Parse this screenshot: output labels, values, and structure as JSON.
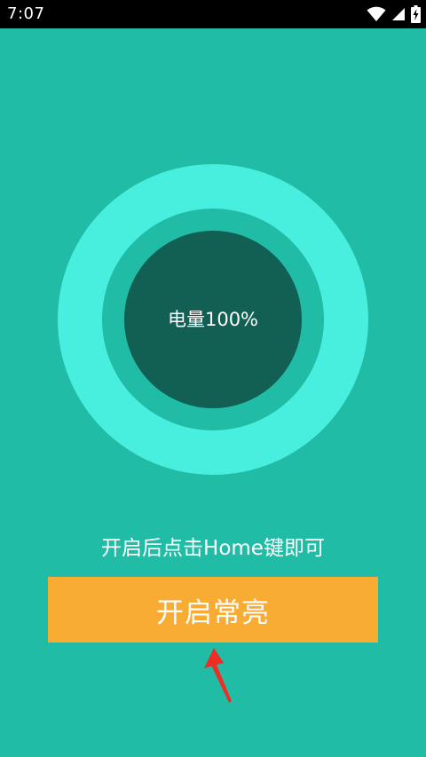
{
  "status_bar": {
    "time": "7:07",
    "icons": [
      "wifi-icon",
      "cell-signal-icon",
      "battery-charging-icon"
    ]
  },
  "battery_display": {
    "text": "电量100%",
    "level_percent": 100
  },
  "hint": {
    "text": "开启后点击Home键即可"
  },
  "keep_on_button": {
    "label": "开启常亮"
  },
  "annotation": {
    "icon": "red-arrow-icon",
    "color": "#EE2E24"
  },
  "colors": {
    "background": "#20BCA6",
    "outer_ring": "#48EEDE",
    "core": "#125F54",
    "button": "#F9AC34",
    "status_bar": "#000000"
  }
}
